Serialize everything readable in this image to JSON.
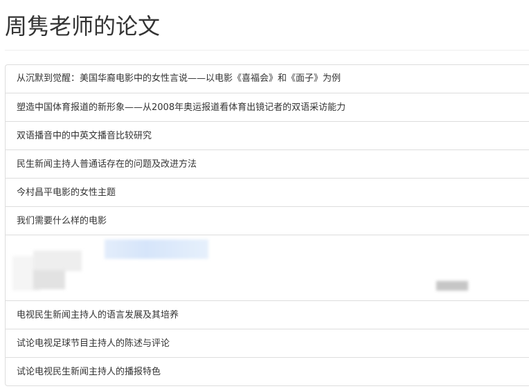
{
  "page": {
    "title": "周隽老师的论文"
  },
  "papers": [
    {
      "title": "从沉默到觉醒：美国华裔电影中的女性言说——以电影《喜福会》和《面子》为例"
    },
    {
      "title": "塑造中国体育报道的新形象——从2008年奥运报道看体育出镜记者的双语采访能力"
    },
    {
      "title": "双语播音中的中英文播音比较研究"
    },
    {
      "title": "民生新闻主持人普通话存在的问题及改进方法"
    },
    {
      "title": "今村昌平电影的女性主题"
    },
    {
      "title": "我们需要什么样的电影"
    },
    {
      "title": ""
    },
    {
      "title": "电视民生新闻主持人的语言发展及其培养"
    },
    {
      "title": "试论电视足球节目主持人的陈述与评论"
    },
    {
      "title": "试论电视民生新闻主持人的播报特色"
    }
  ]
}
